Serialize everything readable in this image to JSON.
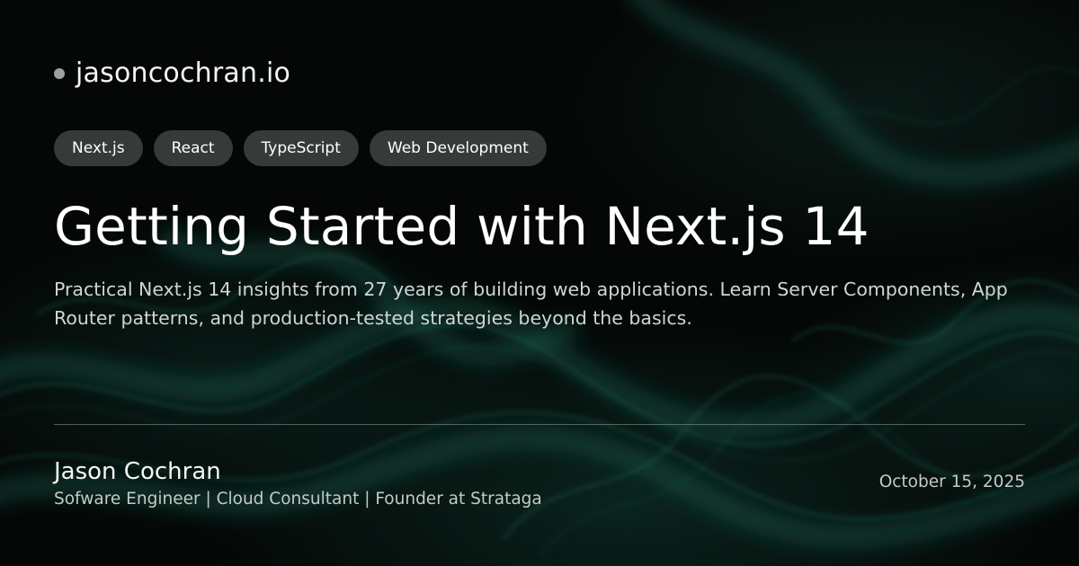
{
  "site": {
    "name": "jasoncochran.io",
    "dot_color": "#9aa3a0"
  },
  "tags": [
    {
      "label": "Next.js"
    },
    {
      "label": "React"
    },
    {
      "label": "TypeScript"
    },
    {
      "label": "Web Development"
    }
  ],
  "article": {
    "title": "Getting Started with Next.js 14",
    "description": "Practical Next.js 14 insights from 27 years of building web applications. Learn Server Components, App Router patterns, and production-tested strategies beyond the basics."
  },
  "author": {
    "name": "Jason Cochran",
    "role": "Sofware Engineer | Cloud Consultant | Founder at Strataga"
  },
  "date": "October 15, 2025",
  "colors": {
    "background": "#040706",
    "smoke": "#1f6b5a",
    "tag_background": "#4c5552"
  }
}
